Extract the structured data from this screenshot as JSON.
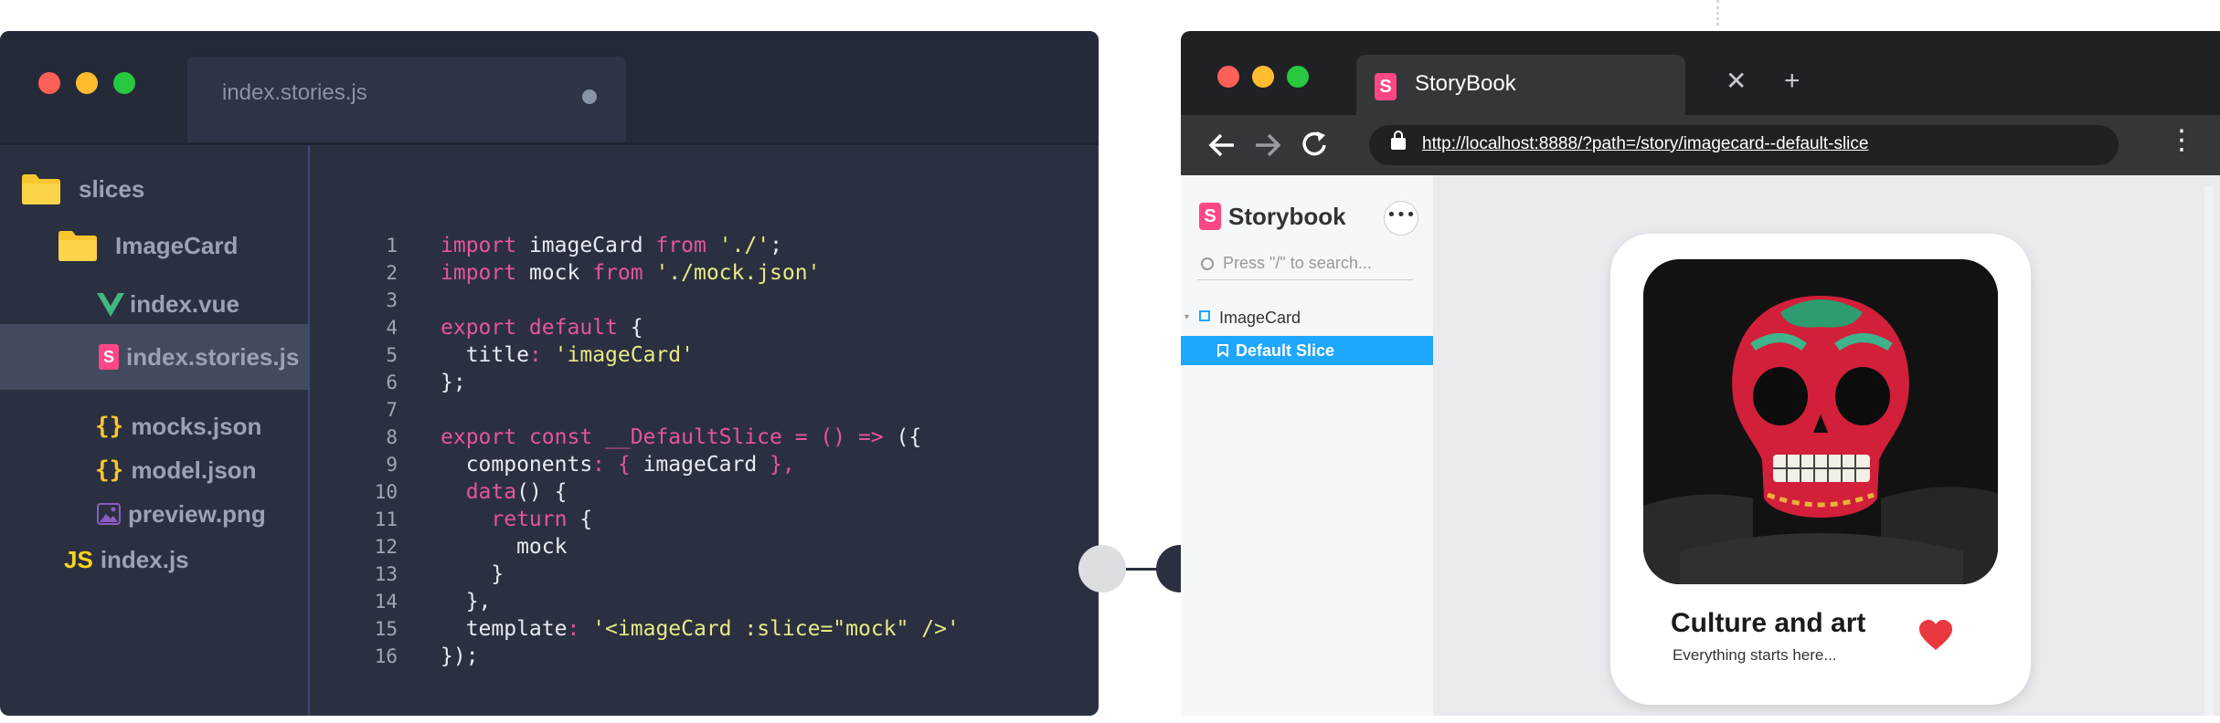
{
  "editor": {
    "tab_label": "index.stories.js",
    "tree": [
      {
        "label": "slices",
        "icon": "folder-icon"
      },
      {
        "label": "ImageCard",
        "icon": "folder-icon"
      },
      {
        "label": "index.vue",
        "icon": "vue-icon"
      },
      {
        "label": "index.stories.js",
        "icon": "storybook-icon",
        "active": true
      },
      {
        "label": "mocks.json",
        "icon": "json-icon"
      },
      {
        "label": "model.json",
        "icon": "json-icon"
      },
      {
        "label": "preview.png",
        "icon": "image-icon"
      },
      {
        "label": "index.js",
        "icon": "js-icon"
      }
    ],
    "line_numbers": [
      "1",
      "2",
      "3",
      "4",
      "5",
      "6",
      "7",
      "8",
      "9",
      "10",
      "11",
      "12",
      "13",
      "14",
      "15",
      "16"
    ]
  },
  "browser": {
    "tab_title": "StoryBook",
    "close_glyph": "✕",
    "new_tab_glyph": "+",
    "url": "http://localhost:8888/?path=/story/imagecard--default-slice"
  },
  "storybook": {
    "name": "Storybook",
    "more_glyph": "•••",
    "search_placeholder": "Press \"/\" to search...",
    "group": "ImageCard",
    "story": "Default Slice"
  },
  "card": {
    "title": "Culture and art",
    "subtitle": "Everything starts here..."
  },
  "colors": {
    "editor_bg": "#2b3040",
    "keyword": "#e4569a",
    "string": "#e7ea86",
    "storybook_pink": "#ff4785",
    "selected_blue": "#1ea7fd",
    "heart_red": "#e9393f"
  }
}
